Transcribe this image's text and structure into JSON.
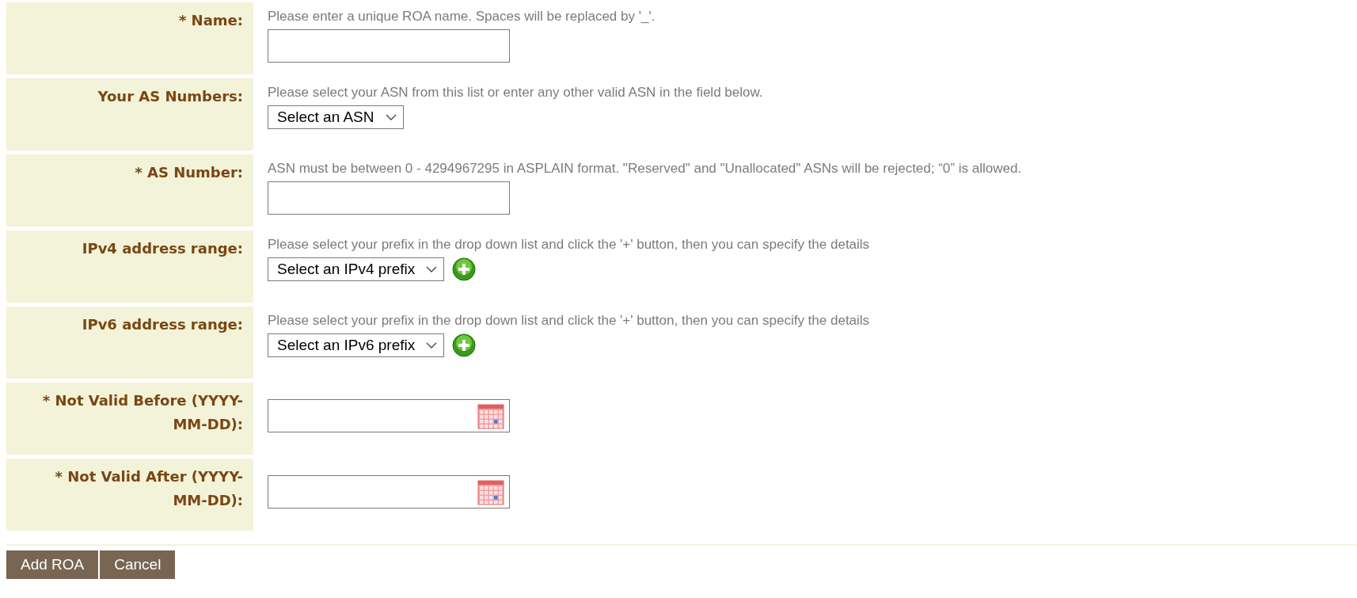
{
  "rows": [
    {
      "kind": "text",
      "label": "* Name:",
      "hint": "Please enter a unique ROA name. Spaces will be replaced by '_'."
    },
    {
      "kind": "select",
      "label": "Your AS Numbers:",
      "hint": "Please select your ASN from this list or enter any other valid ASN in the field below.",
      "select": "Select an ASN"
    },
    {
      "kind": "text",
      "label": "* AS Number:",
      "hint": "ASN must be between 0 - 4294967295 in ASPLAIN format. \"Reserved\" and \"Unallocated\" ASNs will be rejected; “0” is allowed."
    },
    {
      "kind": "select_add",
      "label": "IPv4 address range:",
      "hint": "Please select your prefix in the drop down list and click the '+' button, then you can specify the details",
      "select": "Select an IPv4 prefix"
    },
    {
      "kind": "select_add",
      "label": "IPv6 address range:",
      "hint": "Please select your prefix in the drop down list and click the '+' button, then you can specify the details",
      "select": "Select an IPv6 prefix"
    },
    {
      "kind": "date",
      "label": "* Not Valid Before (YYYY-MM-DD):"
    },
    {
      "kind": "date",
      "label": "* Not Valid After (YYYY-MM-DD):"
    }
  ],
  "buttons": [
    "Add ROA",
    "Cancel"
  ]
}
